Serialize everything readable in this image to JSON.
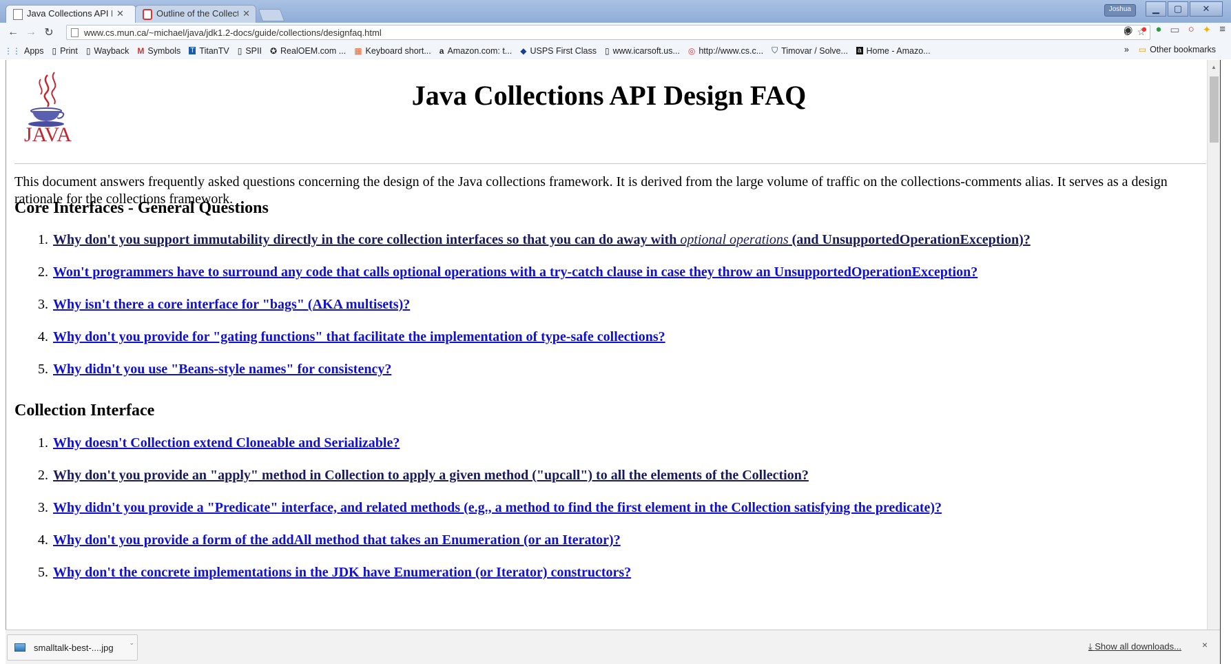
{
  "browser": {
    "tabs": [
      {
        "label": "Java Collections API D",
        "active": true
      },
      {
        "label": "Outline of the Collect",
        "active": false
      }
    ],
    "user_badge": "Joshua",
    "url": "www.cs.mun.ca/~michael/java/jdk1.2-docs/guide/collections/designfaq.html",
    "bookmarks": [
      {
        "label": "Apps",
        "icon": "apps-grid-icon"
      },
      {
        "label": "Print",
        "icon": "page-icon"
      },
      {
        "label": "Wayback",
        "icon": "page-icon"
      },
      {
        "label": "Symbols",
        "icon": "gmail-icon"
      },
      {
        "label": "TitanTV",
        "icon": "titantv-icon"
      },
      {
        "label": "SPII",
        "icon": "page-icon"
      },
      {
        "label": "RealOEM.com ...",
        "icon": "realoem-icon"
      },
      {
        "label": "Keyboard short...",
        "icon": "windows-icon"
      },
      {
        "label": "Amazon.com: t...",
        "icon": "amazon-icon"
      },
      {
        "label": "USPS First Class",
        "icon": "usps-icon"
      },
      {
        "label": "www.icarsoft.us...",
        "icon": "page-icon"
      },
      {
        "label": "http://www.cs.c...",
        "icon": "opera-icon"
      },
      {
        "label": "Timovar / Solve...",
        "icon": "shield-icon"
      },
      {
        "label": "Home - Amazo...",
        "icon": "amazon-icon"
      }
    ],
    "other_bookmarks": "Other bookmarks",
    "more_bookmarks": "»"
  },
  "page": {
    "logo_text": "JAVA",
    "title": "Java Collections API Design FAQ",
    "intro": "This document answers frequently asked questions concerning the design of the Java collections framework. It is derived from the large volume of traffic on the collections-comments alias. It serves as a design rationale for the collections framework.",
    "sections": [
      {
        "title": "Core Interfaces - General Questions",
        "items": [
          {
            "num": "1.",
            "pre": "Why don't you support immutability directly in the core collection interfaces so that you can do away with ",
            "em": "optional operations",
            "post": " (and UnsupportedOperationException)?"
          },
          {
            "num": "2.",
            "text": "Won't programmers have to surround any code that calls optional operations with a try-catch clause in case they throw an UnsupportedOperationException?"
          },
          {
            "num": "3.",
            "text": "Why isn't there a core interface for \"bags\" (AKA multisets)?"
          },
          {
            "num": "4.",
            "text": "Why don't you provide for \"gating functions\" that facilitate the implementation of type-safe collections?"
          },
          {
            "num": "5.",
            "text": "Why didn't you use \"Beans-style names\" for consistency?"
          }
        ]
      },
      {
        "title": "Collection Interface",
        "items": [
          {
            "num": "1.",
            "text": "Why doesn't Collection extend Cloneable and Serializable?"
          },
          {
            "num": "2.",
            "text": "Why don't you provide an \"apply\" method in Collection to apply a given method (\"upcall\") to all the elements of the Collection?"
          },
          {
            "num": "3.",
            "text": "Why didn't you provide a \"Predicate\" interface, and related methods (e.g., a method to find the first element in the Collection satisfying the predicate)?"
          },
          {
            "num": "4.",
            "text": "Why don't you provide a form of the addAll method that takes an Enumeration (or an Iterator)?"
          },
          {
            "num": "5.",
            "text": "Why don't the concrete implementations in the JDK have Enumeration (or Iterator) constructors?"
          }
        ]
      }
    ]
  },
  "downloads": {
    "file_name": "smalltalk-best-....jpg",
    "show_all": "Show all downloads...",
    "close": "×"
  }
}
